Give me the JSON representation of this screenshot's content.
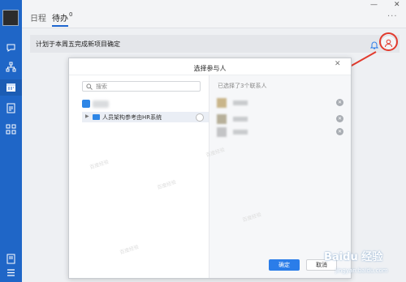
{
  "tabs": [
    {
      "label": "日程"
    },
    {
      "label": "待办",
      "count": "0"
    }
  ],
  "window": {
    "minimize": "—",
    "close": "✕",
    "more": "···"
  },
  "task": {
    "title": "计划于本周五完成新项目确定"
  },
  "dialog": {
    "title": "选择参与人",
    "close": "✕",
    "search_placeholder": "搜索",
    "department": "人员架构参考由HR系统",
    "selected_text": "已选择了3个联系人",
    "contacts_count": 3,
    "confirm": "确定",
    "cancel": "取消"
  },
  "watermark": "百度经验",
  "brand": {
    "logo": "Baidu 经验",
    "domain": "jingyan.baidu.com"
  },
  "colors": {
    "sidebar": "#1f66c7",
    "primary": "#2b7de9",
    "annotation": "#e23b2e"
  },
  "icons": [
    "chat-icon",
    "org-chart-icon",
    "calendar-icon",
    "document-icon",
    "apps-icon",
    "notes-icon",
    "menu-icon",
    "bell-icon",
    "add-participant-icon",
    "search-icon",
    "folder-icon"
  ]
}
